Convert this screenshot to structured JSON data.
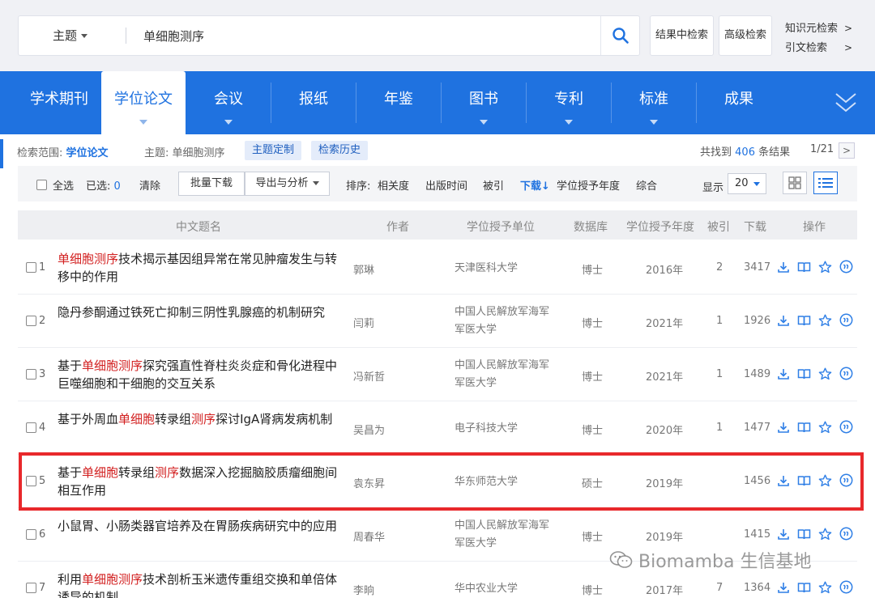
{
  "search": {
    "field": "主题",
    "query": "单细胞测序",
    "in_results": "结果中检索",
    "advanced": "高级检索",
    "knowledge_search": "知识元检索",
    "citation_search": "引文检索",
    "link_arrow": ">"
  },
  "nav": {
    "tabs": [
      "学术期刊",
      "学位论文",
      "会议",
      "报纸",
      "年鉴",
      "图书",
      "专利",
      "标准",
      "成果"
    ],
    "active": "学位论文"
  },
  "scope": {
    "range_label": "检索范围:",
    "range_value": "学位论文",
    "topic_label": "主题:",
    "topic_value": "单细胞测序",
    "custom_btn": "主题定制",
    "history_btn": "检索历史",
    "found_prefix": "共找到",
    "found_count": "406",
    "found_suffix": "条结果",
    "page": "1/21",
    "next": ">"
  },
  "toolbar": {
    "select_all": "全选",
    "selected_label": "已选:",
    "selected_count": "0",
    "clear": "清除",
    "batch_download": "批量下载",
    "export": "导出与分析",
    "sort_label": "排序:",
    "sort_options": [
      "相关度",
      "出版时间",
      "被引",
      "下载↓",
      "学位授予年度",
      "综合"
    ],
    "sort_active": "下载↓",
    "display_label": "显示",
    "page_size": "20"
  },
  "table": {
    "headers": {
      "title": "中文题名",
      "author": "作者",
      "unit": "学位授予单位",
      "db": "数据库",
      "year": "学位授予年度",
      "cited": "被引",
      "downloads": "下载",
      "ops": "操作"
    },
    "rows": [
      {
        "num": "1",
        "t1": "单细胞测序",
        "t2": "技术揭示基因组异常在常见肿瘤发生与转移中的作用",
        "t3": "",
        "t4": "",
        "t5": "",
        "author": "郭琳",
        "unit": "天津医科大学",
        "db": "博士",
        "year": "2016年",
        "cited": "2",
        "downloads": "3417"
      },
      {
        "num": "2",
        "t1": "隐丹参酮通过铁死亡抑制三阴性乳腺癌的机制研究",
        "t2": "",
        "t3": "",
        "t4": "",
        "t5": "",
        "author": "闫莉",
        "unit": "中国人民解放军海军军医大学",
        "db": "博士",
        "year": "2021年",
        "cited": "1",
        "downloads": "1926"
      },
      {
        "num": "3",
        "t1": "基于",
        "t2": "单细胞测序",
        "t3": "探究强直性脊柱炎炎症和骨化进程中巨噬细胞和干细胞的交互关系",
        "t4": "",
        "t5": "",
        "author": "冯新哲",
        "unit": "中国人民解放军海军军医大学",
        "db": "博士",
        "year": "2021年",
        "cited": "1",
        "downloads": "1489"
      },
      {
        "num": "4",
        "t1": "基于外周血",
        "t2": "单细胞",
        "t3": "转录组",
        "t4": "测序",
        "t5": "探讨IgA肾病发病机制",
        "author": "吴昌为",
        "unit": "电子科技大学",
        "db": "博士",
        "year": "2020年",
        "cited": "1",
        "downloads": "1477"
      },
      {
        "num": "5",
        "t1": "基于",
        "t2": "单细胞",
        "t3": "转录组",
        "t4": "测序",
        "t5": "数据深入挖掘脑胶质瘤细胞间相互作用",
        "author": "袁东昇",
        "unit": "华东师范大学",
        "db": "硕士",
        "year": "2019年",
        "cited": "",
        "downloads": "1456"
      },
      {
        "num": "6",
        "t1": "小鼠胃、小肠类器官培养及在胃肠疾病研究中的应用",
        "t2": "",
        "t3": "",
        "t4": "",
        "t5": "",
        "author": "周春华",
        "unit": "中国人民解放军海军军医大学",
        "db": "博士",
        "year": "2019年",
        "cited": "",
        "downloads": "1415"
      },
      {
        "num": "7",
        "t1": "利用",
        "t2": "单细胞测序",
        "t3": "技术剖析玉米遗传重组交换和单倍体诱导的机制",
        "t4": "",
        "t5": "",
        "author": "李晌",
        "unit": "华中农业大学",
        "db": "博士",
        "year": "2017年",
        "cited": "7",
        "downloads": "1364"
      }
    ]
  },
  "watermark": "Biomamba 生信基地",
  "colors": {
    "brand_blue": "#1f72e0",
    "highlight_red": "#d21f1f",
    "annotation_box": "#e8282b"
  }
}
